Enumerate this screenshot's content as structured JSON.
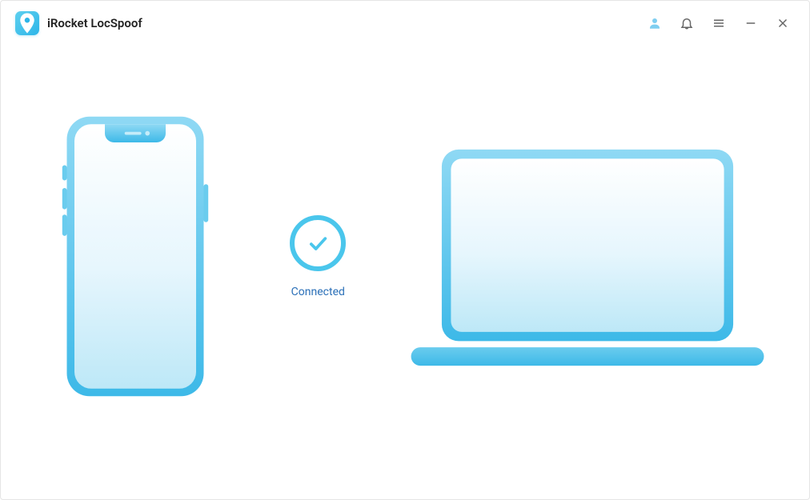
{
  "header": {
    "app_title": "iRocket LocSpoof"
  },
  "status": {
    "label": "Connected"
  },
  "icons": {
    "logo": "location-pin-icon",
    "user": "user-icon",
    "bell": "bell-icon",
    "menu": "hamburger-icon",
    "minimize": "minimize-icon",
    "close": "close-icon",
    "check": "check-icon",
    "phone": "phone-device-icon",
    "laptop": "laptop-device-icon"
  },
  "colors": {
    "accent_light": "#8fd9f4",
    "accent_mid": "#4ac6ec",
    "accent_deep": "#2db5e8",
    "link_text": "#2b70b8"
  }
}
